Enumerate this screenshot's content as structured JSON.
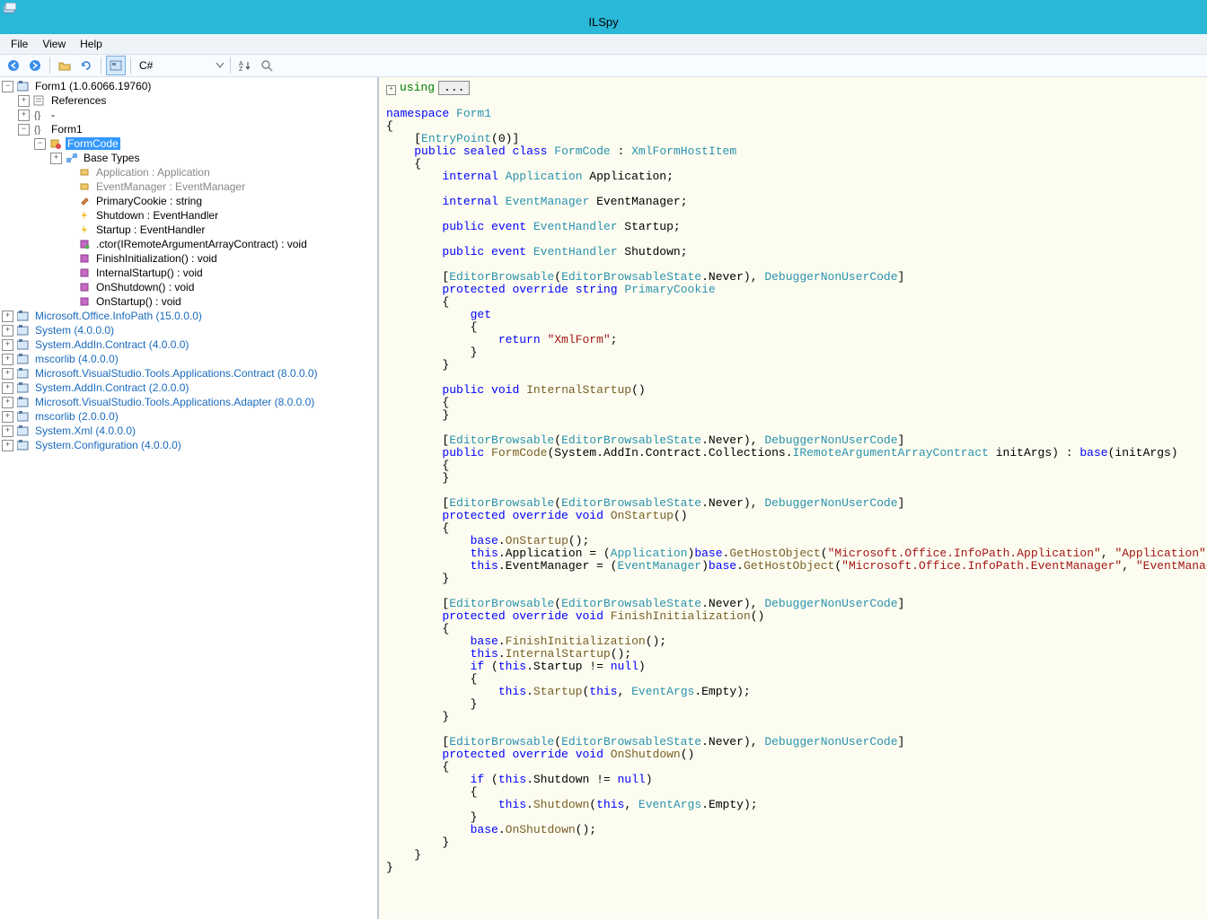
{
  "window": {
    "title": "ILSpy"
  },
  "menu": {
    "file": "File",
    "view": "View",
    "help": "Help"
  },
  "toolbar": {
    "language": "C#"
  },
  "tree": {
    "root": "Form1 (1.0.6066.19760)",
    "refs": "References",
    "dash": "-",
    "form1": "Form1",
    "formcode": "FormCode",
    "basetypes": "Base Types",
    "app": "Application : Application",
    "evmgr": "EventManager : EventManager",
    "pcookie": "PrimaryCookie : string",
    "shutdown": "Shutdown : EventHandler",
    "startup": "Startup : EventHandler",
    "ctor": ".ctor(IRemoteArgumentArrayContract) : void",
    "finit": "FinishInitialization() : void",
    "istart": "InternalStartup() : void",
    "onshut": "OnShutdown() : void",
    "onstart": "OnStartup() : void",
    "a1": "Microsoft.Office.InfoPath (15.0.0.0)",
    "a2": "System (4.0.0.0)",
    "a3": "System.AddIn.Contract (4.0.0.0)",
    "a4": "mscorlib (4.0.0.0)",
    "a5": "Microsoft.VisualStudio.Tools.Applications.Contract (8.0.0.0)",
    "a6": "System.AddIn.Contract (2.0.0.0)",
    "a7": "Microsoft.VisualStudio.Tools.Applications.Adapter (8.0.0.0)",
    "a8": "mscorlib (2.0.0.0)",
    "a9": "System.Xml (4.0.0.0)",
    "a10": "System.Configuration (4.0.0.0)"
  },
  "code": {
    "usingbox": "..."
  }
}
